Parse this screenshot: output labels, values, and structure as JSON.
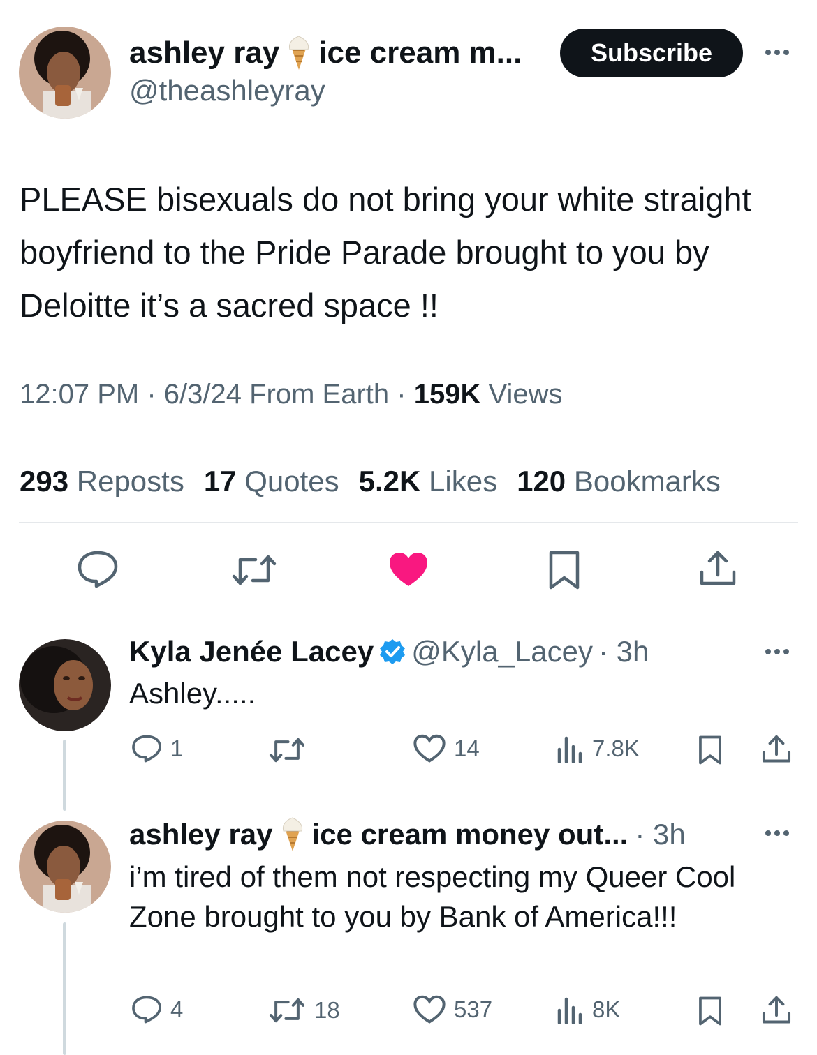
{
  "main_tweet": {
    "author_name": "ashley ray",
    "author_name_suffix": "ice cream m...",
    "author_handle": "@theashleyray",
    "subscribe_label": "Subscribe",
    "text": "PLEASE bisexuals do not bring your white straight boyfriend to the Pride Parade brought to you by Deloitte it’s a sacred space !!",
    "time": "12:07 PM",
    "sep1": "·",
    "date_place": "6/3/24 From Earth",
    "sep2": "·",
    "views_count": "159K",
    "views_label": "Views",
    "stats": [
      {
        "count": "293",
        "label": "Reposts"
      },
      {
        "count": "17",
        "label": "Quotes"
      },
      {
        "count": "5.2K",
        "label": "Likes"
      },
      {
        "count": "120",
        "label": "Bookmarks"
      }
    ],
    "actions": {
      "reply_icon": "reply-icon",
      "repost_icon": "repost-icon",
      "like_icon": "heart-filled-icon",
      "bookmark_icon": "bookmark-icon",
      "share_icon": "share-icon"
    },
    "like_color": "#f91880"
  },
  "replies": [
    {
      "author_name": "Kyla Jenée Lacey",
      "verified": true,
      "author_handle": "@Kyla_Lacey",
      "time": "· 3h",
      "text": "Ashley.....",
      "reply_count": "1",
      "repost_count": "",
      "like_count": "14",
      "views_count": "7.8K"
    },
    {
      "author_name": "ashley ray",
      "author_name_suffix": "ice cream money out...",
      "verified": false,
      "author_handle": "",
      "time": "· 3h",
      "text": "i’m tired of them not respecting my Queer Cool Zone brought to you by Bank of America!!!",
      "reply_count": "4",
      "repost_count": "18",
      "like_count": "537",
      "views_count": "8K"
    }
  ],
  "colors": {
    "text": "#0f1419",
    "secondary": "#536471",
    "verified": "#1d9bf0",
    "divider": "#e5e8eb"
  }
}
